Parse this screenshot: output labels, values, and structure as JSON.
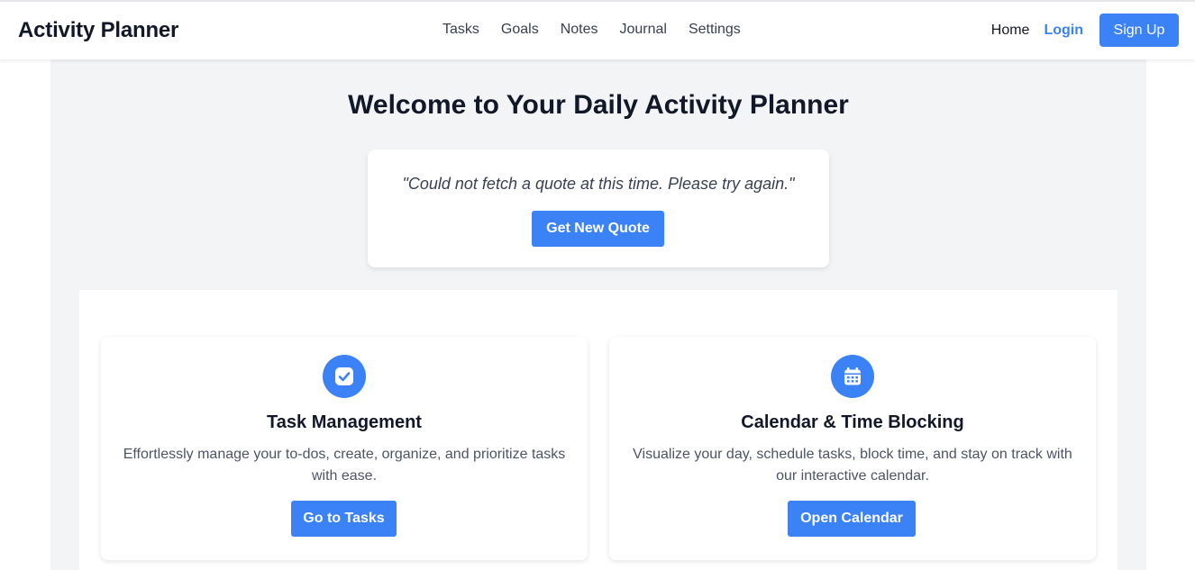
{
  "app": {
    "title": "Activity Planner"
  },
  "nav": {
    "links": [
      "Tasks",
      "Goals",
      "Notes",
      "Journal",
      "Settings"
    ],
    "home": "Home",
    "login": "Login",
    "signup": "Sign Up"
  },
  "main": {
    "heading": "Welcome to Your Daily Activity Planner",
    "quote": {
      "text": "\"Could not fetch a quote at this time. Please try again.\"",
      "button": "Get New Quote"
    },
    "features": [
      {
        "icon": "check-circle-icon",
        "title": "Task Management",
        "description": "Effortlessly manage your to-dos, create, organize, and prioritize tasks with ease.",
        "button": "Go to Tasks"
      },
      {
        "icon": "calendar-icon",
        "title": "Calendar & Time Blocking",
        "description": "Visualize your day, schedule tasks, block time, and stay on track with our interactive calendar.",
        "button": "Open Calendar"
      }
    ]
  },
  "colors": {
    "accent": "#3b82f6",
    "background": "#f3f4f6"
  }
}
